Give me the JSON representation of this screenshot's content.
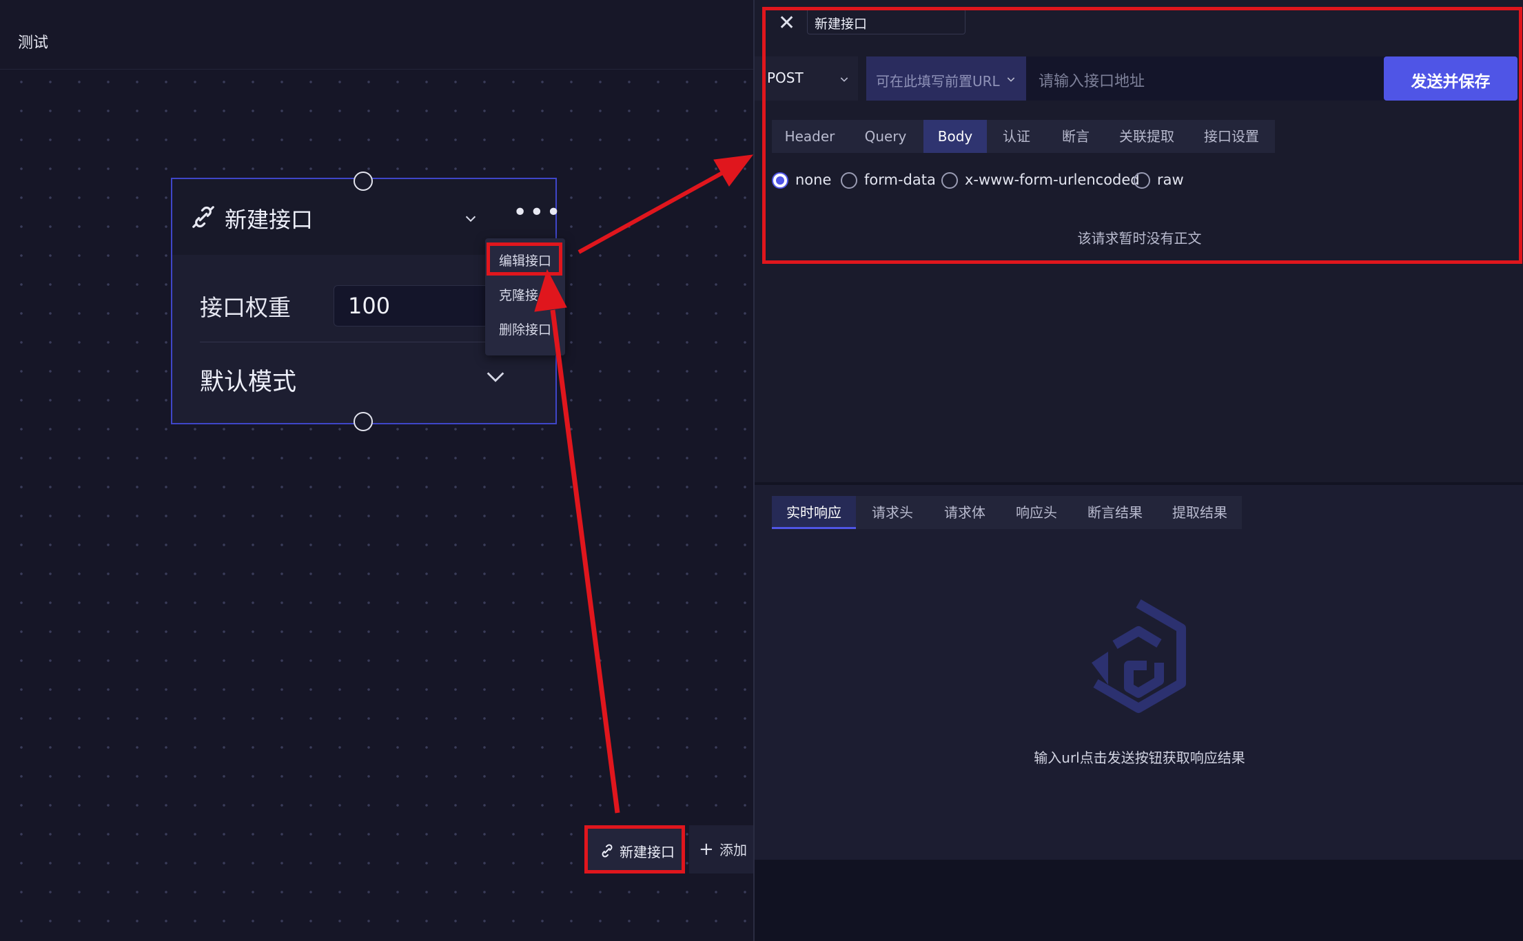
{
  "canvas": {
    "title": "测试",
    "node": {
      "title": "新建接口",
      "weight_label": "接口权重",
      "weight_value": "100",
      "mode_label": "默认模式"
    },
    "context_menu": {
      "items": [
        "编辑接口",
        "克隆接",
        "删除接口"
      ]
    },
    "toolbar": {
      "new_api_label": "新建接口",
      "add_label": "添加"
    }
  },
  "panel": {
    "api_name": "新建接口",
    "method": "POST",
    "prefix_placeholder": "可在此填写前置URL",
    "url_placeholder": "请输入接口地址",
    "send_label": "发送并保存",
    "request_tabs": [
      "Header",
      "Query",
      "Body",
      "认证",
      "断言",
      "关联提取",
      "接口设置"
    ],
    "active_request_tab": "Body",
    "body_types": [
      "none",
      "form-data",
      "x-www-form-urlencoded",
      "raw"
    ],
    "selected_body_type": "none",
    "no_body_text": "该请求暂时没有正文",
    "response_tabs": [
      "实时响应",
      "请求头",
      "请求体",
      "响应头",
      "断言结果",
      "提取结果"
    ],
    "active_response_tab": "实时响应",
    "response_hint": "输入url点击发送按钮获取响应结果"
  },
  "colors": {
    "accent": "#4f55e6",
    "annotation_red": "#e0161d",
    "background": "#161627"
  },
  "icons": [
    "link-icon",
    "chevron-down-icon",
    "more-icon",
    "close-icon",
    "plus-icon",
    "logo-icon"
  ]
}
